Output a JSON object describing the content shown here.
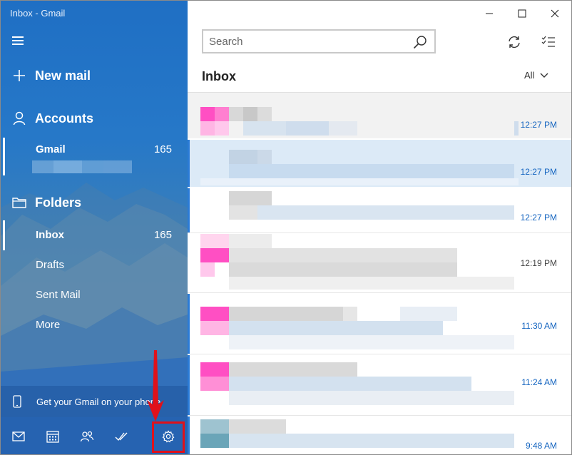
{
  "window": {
    "title": "Inbox - Gmail"
  },
  "sidebar": {
    "new_mail": "New mail",
    "accounts_heading": "Accounts",
    "account": {
      "name": "Gmail",
      "count": "165"
    },
    "folders_heading": "Folders",
    "folders": [
      {
        "label": "Inbox",
        "count": "165"
      },
      {
        "label": "Drafts",
        "count": ""
      },
      {
        "label": "Sent Mail",
        "count": ""
      },
      {
        "label": "More",
        "count": ""
      }
    ],
    "promo": "Get your Gmail on your phone"
  },
  "main": {
    "search_placeholder": "Search",
    "title": "Inbox",
    "filter": "All"
  },
  "messages": [
    {
      "time": "12:27 PM",
      "unread": true
    },
    {
      "time": "12:27 PM",
      "unread": true
    },
    {
      "time": "12:27 PM",
      "unread": true
    },
    {
      "time": "12:19 PM",
      "unread": false
    },
    {
      "time": "11:30 AM",
      "unread": true
    },
    {
      "time": "11:24 AM",
      "unread": true
    },
    {
      "time": "9:48 AM",
      "unread": true
    }
  ],
  "colors": {
    "accent": "#2b7bd6",
    "time_unread": "#1565c0",
    "highlight": "#e0111a"
  }
}
